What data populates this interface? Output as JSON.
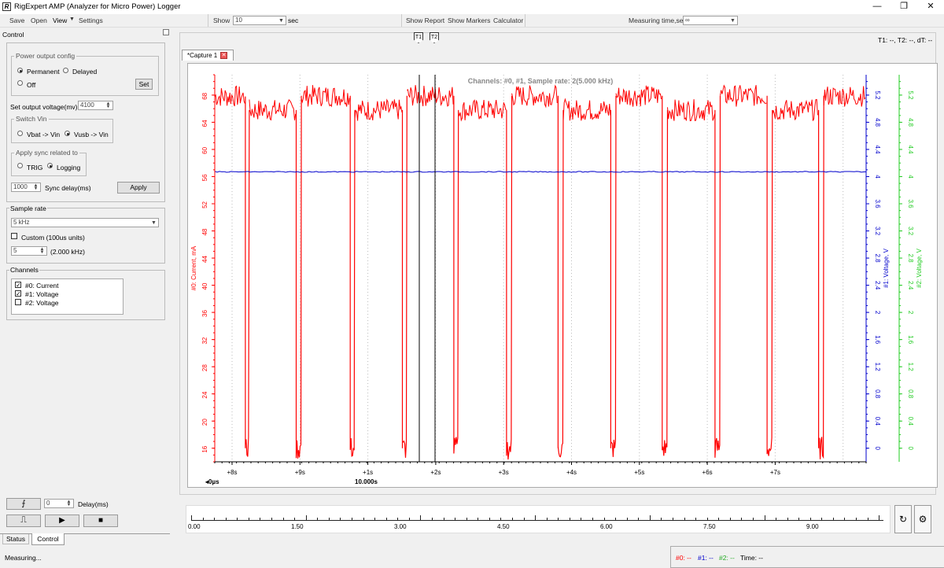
{
  "window": {
    "title": "RigExpert AMP (Analyzer for Micro Power) Logger",
    "minimize": "—",
    "maximize": "❐",
    "close": "✕",
    "icon": "R"
  },
  "toolbar": {
    "save": "Save",
    "open": "Open",
    "view": "View",
    "settings": "Settings",
    "show_label": "Show",
    "show_value": "10",
    "show_unit": "sec",
    "show_report": "Show Report",
    "show_markers": "Show Markers",
    "calculator": "Calculator",
    "measuring_time_label": "Measuring time,sec",
    "measuring_time_value": "∞"
  },
  "control": {
    "title": "Control",
    "power_output": {
      "label": "Power output config",
      "permanent": "Permanent",
      "delayed": "Delayed",
      "off": "Off",
      "set": "Set",
      "selected": "Permanent"
    },
    "output_voltage": {
      "label": "Set output voltage(mv)",
      "value": "4100"
    },
    "switch_vin": {
      "label": "Switch Vin",
      "vbat": "Vbat -> Vin",
      "vusb": "Vusb -> Vin",
      "selected": "Vusb -> Vin"
    },
    "sync": {
      "label": "Apply sync related to",
      "trig": "TRIG",
      "logging": "Logging",
      "selected": "Logging"
    },
    "sync_delay": {
      "value": "1000",
      "label": "Sync delay(ms)",
      "apply": "Apply"
    }
  },
  "sample_rate": {
    "title": "Sample rate",
    "value": "5 kHz",
    "custom_label": "Custom (100us units)",
    "custom_value": "5",
    "custom_freq": "(2.000 kHz)"
  },
  "channels": {
    "title": "Channels",
    "items": [
      {
        "label": "#0: Current",
        "checked": true
      },
      {
        "label": "#1: Voltage",
        "checked": true
      },
      {
        "label": "#2: Voltage",
        "checked": false
      }
    ]
  },
  "bottom_left": {
    "delay_value": "0",
    "delay_label": "Delay(ms)",
    "tab_status": "Status",
    "tab_control": "Control",
    "edge_icon": "⨍",
    "pulse_icon": "⎍",
    "play_icon": "▶",
    "stop_icon": "■"
  },
  "capture": {
    "tab": "*Capture 1",
    "markers_readout": "T1: --, T2: --, dT: --",
    "marker1": "T1",
    "marker2": "T2",
    "header": "Channels: #0, #1, Sample rate: 2(5.000 kHz)"
  },
  "timeline": {
    "labels": [
      "0.00",
      "1.50",
      "3.00",
      "4.50",
      "6.00",
      "7.50",
      "9.00"
    ]
  },
  "status": {
    "text": "Measuring...",
    "ch0": "#0: --",
    "ch1": "#1: --",
    "ch2": "#2: --",
    "time": "Time: --"
  },
  "colors": {
    "ch0": "#ff0000",
    "ch1": "#0000cc",
    "ch2": "#22cc22"
  },
  "chart_data": {
    "type": "line",
    "title": "Channels: #0, #1, Sample rate: 2(5.000 kHz)",
    "x_tick_labels": [
      "+8s",
      "+9s",
      "+1s",
      "+2s",
      "+3s",
      "+4s",
      "+5s",
      "+6s",
      "+7s"
    ],
    "x_sub_labels": [
      "◂0µs",
      "10.000s"
    ],
    "y_left": {
      "label": "#0: Current, mA",
      "ticks": [
        16,
        20,
        24,
        28,
        32,
        36,
        40,
        44,
        48,
        52,
        56,
        60,
        64,
        68
      ],
      "range": [
        14,
        71
      ]
    },
    "y_right1": {
      "label": "#1: Voltage, V",
      "ticks": [
        0,
        0.4,
        0.8,
        1.2,
        1.6,
        2,
        2.4,
        2.8,
        3.2,
        3.6,
        4,
        4.4,
        4.8,
        5.2
      ],
      "range": [
        -0.2,
        5.5
      ]
    },
    "y_right2": {
      "label": "#2: Voltage, V",
      "ticks": [
        0,
        0.4,
        0.8,
        1.2,
        1.6,
        2,
        2.4,
        2.8,
        3.2,
        3.6,
        4,
        4.4,
        4.8,
        5.2
      ],
      "range": [
        -0.2,
        5.5
      ]
    },
    "x_range_s": [
      0,
      10
    ],
    "series": [
      {
        "name": "#0: Current, mA",
        "segments": [
          {
            "start": 0.0,
            "end": 0.47,
            "high": 67.8
          },
          {
            "start": 0.53,
            "end": 1.25,
            "high": 65.8
          },
          {
            "start": 1.33,
            "end": 2.08,
            "high": 67.9
          },
          {
            "start": 2.15,
            "end": 2.88,
            "high": 65.8
          },
          {
            "start": 2.95,
            "end": 3.67,
            "high": 67.9
          },
          {
            "start": 3.74,
            "end": 4.48,
            "high": 65.8
          },
          {
            "start": 4.56,
            "end": 5.27,
            "high": 67.9
          },
          {
            "start": 5.35,
            "end": 6.08,
            "high": 65.8
          },
          {
            "start": 6.16,
            "end": 6.87,
            "high": 67.9
          },
          {
            "start": 6.95,
            "end": 7.68,
            "high": 65.8
          },
          {
            "start": 7.76,
            "end": 8.48,
            "high": 67.9
          },
          {
            "start": 8.56,
            "end": 9.27,
            "high": 65.8
          },
          {
            "start": 9.35,
            "end": 10.0,
            "high": 67.9
          }
        ],
        "low": 16.0
      },
      {
        "name": "#1: Voltage, V",
        "value": 4.07
      }
    ]
  }
}
